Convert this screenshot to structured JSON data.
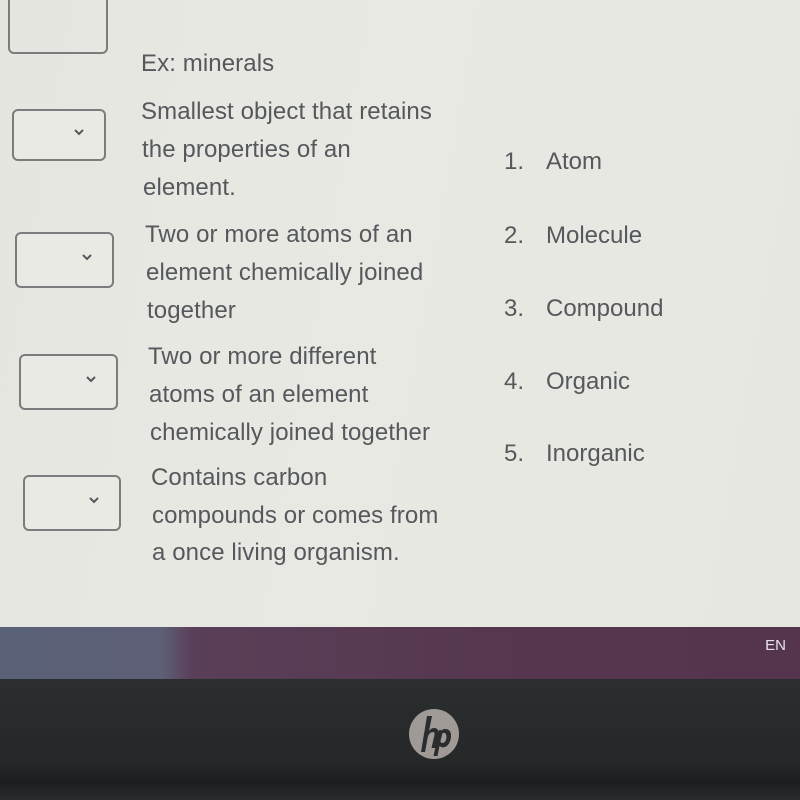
{
  "question": {
    "example_text": "Ex: minerals",
    "rows": [
      {
        "lines": [
          "Smallest object that retains",
          "the properties of an",
          "element."
        ],
        "selected": ""
      },
      {
        "lines": [
          "Two or more atoms of an",
          "element chemically joined",
          "together"
        ],
        "selected": ""
      },
      {
        "lines": [
          "Two or more different",
          "atoms of an element",
          "chemically joined together"
        ],
        "selected": ""
      },
      {
        "lines": [
          "Contains carbon",
          "compounds or comes from",
          "a once living organism."
        ],
        "selected": ""
      }
    ],
    "answers": [
      {
        "num": "1.",
        "label": "Atom"
      },
      {
        "num": "2.",
        "label": "Molecule"
      },
      {
        "num": "3.",
        "label": "Compound"
      },
      {
        "num": "4.",
        "label": "Organic"
      },
      {
        "num": "5.",
        "label": "Inorganic"
      }
    ]
  },
  "taskbar": {
    "language": "EN"
  },
  "device": {
    "logo_icon": "hp-logo-icon"
  },
  "colors": {
    "text": "#55585c",
    "dropdown_border": "#7a7c7e",
    "screen_bg": "#e8e8e2",
    "taskbar_purple": "#56374f",
    "taskbar_blue": "#5a6278",
    "bezel": "#252728"
  }
}
